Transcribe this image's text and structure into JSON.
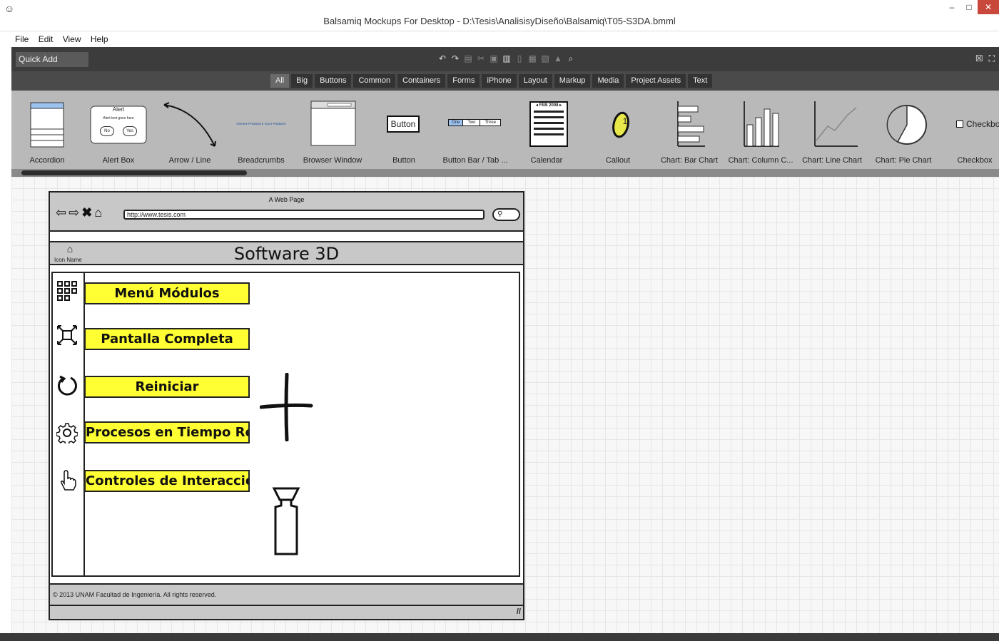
{
  "window": {
    "title": "Balsamiq Mockups For Desktop - D:\\Tesis\\AnalisisyDiseño\\Balsamiq\\T05-S3DA.bmml",
    "app_icon": "smiley-icon",
    "min_glyph": "–",
    "max_glyph": "□",
    "close_glyph": "✕",
    "close_color": "#c9483c"
  },
  "menubar": [
    "File",
    "Edit",
    "View",
    "Help"
  ],
  "toolbar": {
    "quick_add_placeholder": "Quick Add",
    "icons": [
      "undo-icon",
      "redo-icon",
      "copy-icon",
      "cut-icon",
      "paste-icon",
      "clipboard-icon",
      "delete-icon",
      "group-icon",
      "ungroup-icon",
      "lock-icon",
      "search-icon"
    ],
    "right_icons": [
      "close-panel-icon",
      "fullscreen-icon"
    ]
  },
  "filters": [
    "All",
    "Big",
    "Buttons",
    "Common",
    "Containers",
    "Forms",
    "iPhone",
    "Layout",
    "Markup",
    "Media",
    "Project Assets",
    "Text"
  ],
  "active_filter": "All",
  "library": {
    "items": [
      {
        "label": "Accordion"
      },
      {
        "label": "Alert Box"
      },
      {
        "label": "Arrow / Line"
      },
      {
        "label": "Breadcrumbs"
      },
      {
        "label": "Browser Window"
      },
      {
        "label": "Button"
      },
      {
        "label": "Button Bar / Tab ..."
      },
      {
        "label": "Calendar"
      },
      {
        "label": "Callout"
      },
      {
        "label": "Chart: Bar Chart"
      },
      {
        "label": "Chart: Column C..."
      },
      {
        "label": "Chart: Line Chart"
      },
      {
        "label": "Chart: Pie Chart"
      },
      {
        "label": "Checkbox"
      }
    ],
    "thumb_texts": {
      "alert_title": "Alert",
      "alert_text": "Alert text goes here",
      "alert_no": "No",
      "alert_yes": "Yes",
      "button_text": "Button",
      "buttonbar": [
        "One",
        "Two",
        "Three"
      ],
      "calendar_header": "◂ FEB 2008 ▸",
      "callout_number": "1",
      "checkbox_text": "Checkbox",
      "breadcrumb_text": "Home ▸ Products ▸ Xyz ▸ Features"
    }
  },
  "mockup": {
    "page_title": "A Web Page",
    "url": "http://www.tesis.com",
    "icon_name": "Icon Name",
    "heading": "Software 3D",
    "menu": [
      {
        "label": "Menú Módulos",
        "icon": "grid-icon"
      },
      {
        "label": "Pantalla Completa",
        "icon": "fullscreen-icon"
      },
      {
        "label": "Reiniciar",
        "icon": "refresh-icon"
      },
      {
        "label": "Procesos en Tiempo Real",
        "icon": "gear-icon"
      },
      {
        "label": "Controles de Interacción",
        "icon": "hand-icon"
      }
    ],
    "footer": "© 2013 UNAM Facultad de Ingeniería. All rights reserved.",
    "button_color": "#ffff33"
  }
}
